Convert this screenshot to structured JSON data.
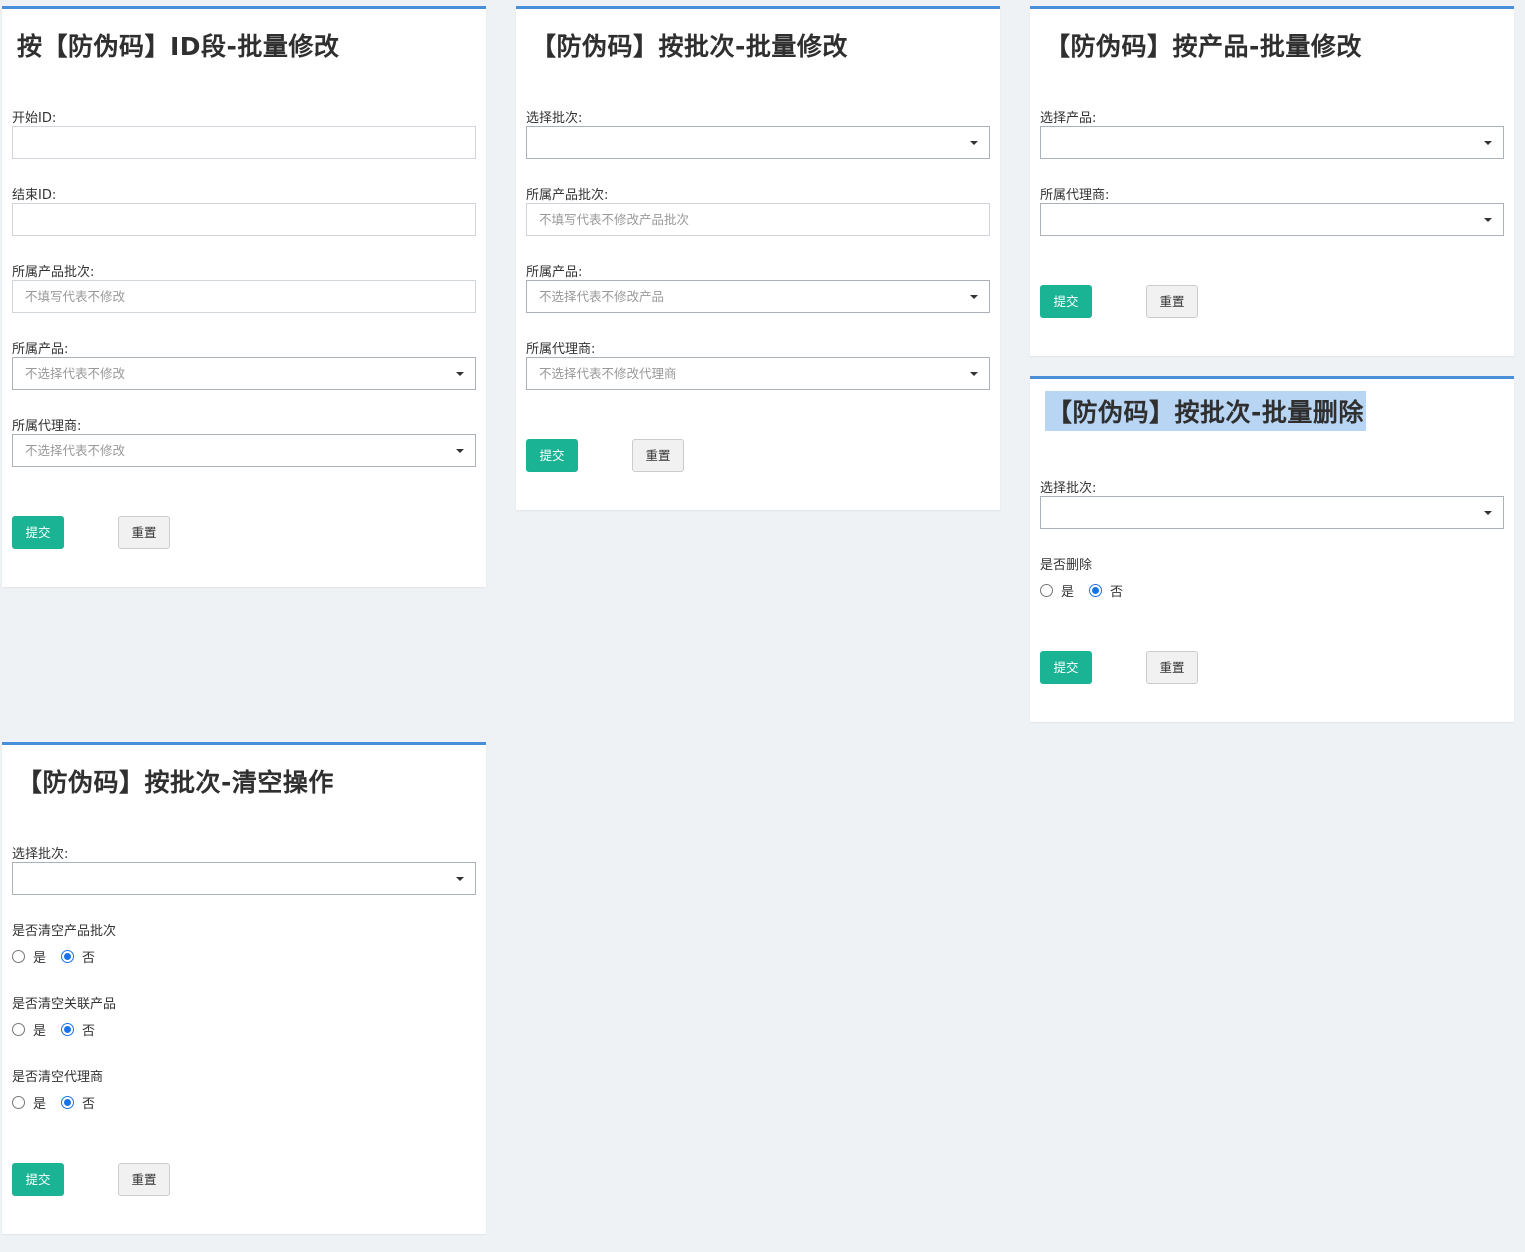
{
  "panel_id_range": {
    "title": "按【防伪码】ID段-批量修改",
    "start_id_label": "开始ID:",
    "start_id_value": "",
    "end_id_label": "结束ID:",
    "end_id_value": "",
    "batch_label": "所属产品批次:",
    "batch_placeholder": "不填写代表不修改",
    "product_label": "所属产品:",
    "product_value": "不选择代表不修改",
    "agent_label": "所属代理商:",
    "agent_value": "不选择代表不修改",
    "submit": "提交",
    "reset": "重置"
  },
  "panel_by_batch": {
    "title": "【防伪码】按批次-批量修改",
    "select_batch_label": "选择批次:",
    "select_batch_value": "",
    "product_batch_label": "所属产品批次:",
    "product_batch_placeholder": "不填写代表不修改产品批次",
    "product_label": "所属产品:",
    "product_value": "不选择代表不修改产品",
    "agent_label": "所属代理商:",
    "agent_value": "不选择代表不修改代理商",
    "submit": "提交",
    "reset": "重置"
  },
  "panel_by_product": {
    "title": "【防伪码】按产品-批量修改",
    "select_product_label": "选择产品:",
    "select_product_value": "",
    "agent_label": "所属代理商:",
    "agent_value": "",
    "submit": "提交",
    "reset": "重置"
  },
  "panel_batch_delete": {
    "title": "【防伪码】按批次-批量删除",
    "select_batch_label": "选择批次:",
    "select_batch_value": "",
    "delete_label": "是否删除",
    "yes": "是",
    "no": "否",
    "selected": "否",
    "submit": "提交",
    "reset": "重置"
  },
  "panel_clear": {
    "title": "【防伪码】按批次-清空操作",
    "select_batch_label": "选择批次:",
    "select_batch_value": "",
    "clear_batch_label": "是否清空产品批次",
    "clear_product_label": "是否清空关联产品",
    "clear_agent_label": "是否清空代理商",
    "yes": "是",
    "no": "否",
    "clear_batch_selected": "否",
    "clear_product_selected": "否",
    "clear_agent_selected": "否",
    "submit": "提交",
    "reset": "重置"
  },
  "colors": {
    "page_bg": "#eef2f5",
    "panel_border_top": "#4a90d9",
    "submit_button": "#1ab394",
    "title_selection": "#b9d5f4",
    "radio_checked": "#1a73e8"
  },
  "icons": {
    "dropdown": "caret-down-icon"
  }
}
